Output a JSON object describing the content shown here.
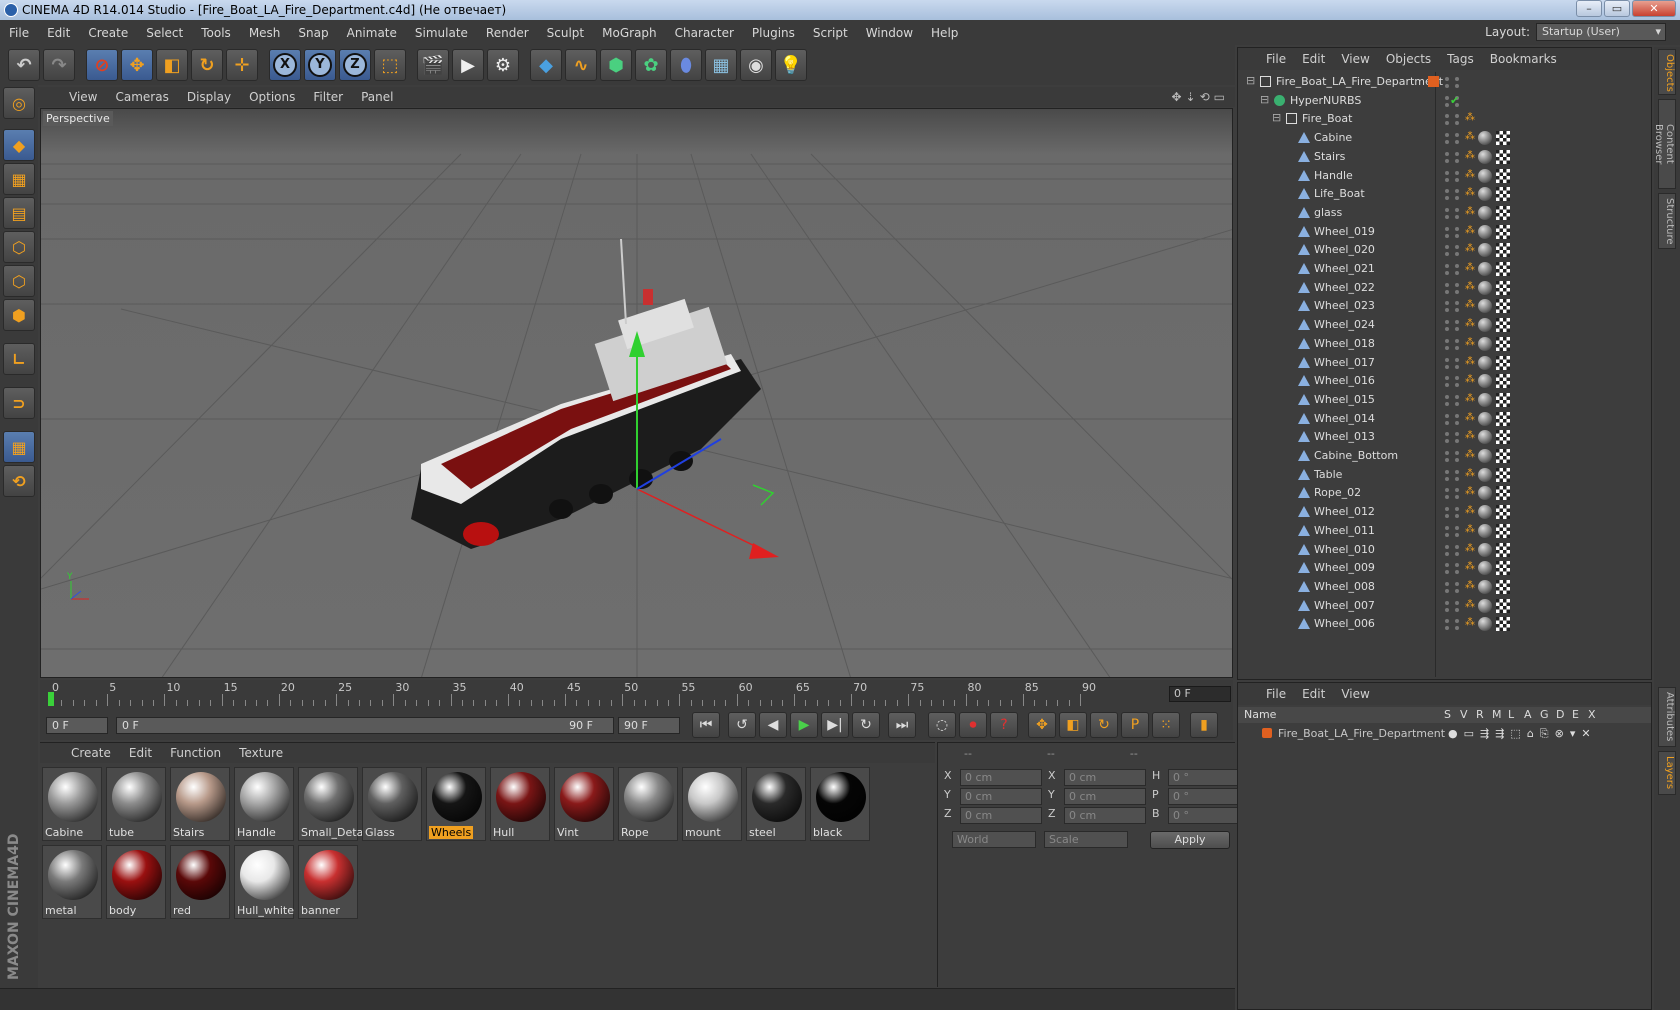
{
  "window": {
    "title": "CINEMA 4D R14.014 Studio - [Fire_Boat_LA_Fire_Department.c4d] (Не отвечает)"
  },
  "menu": [
    "File",
    "Edit",
    "Create",
    "Select",
    "Tools",
    "Mesh",
    "Snap",
    "Animate",
    "Simulate",
    "Render",
    "Sculpt",
    "MoGraph",
    "Character",
    "Plugins",
    "Script",
    "Window",
    "Help"
  ],
  "layout": {
    "label": "Layout:",
    "value": "Startup (User)"
  },
  "viewport": {
    "menu": [
      "View",
      "Cameras",
      "Display",
      "Options",
      "Filter",
      "Panel"
    ],
    "label": "Perspective"
  },
  "timeline": {
    "ticks": [
      "0",
      "5",
      "10",
      "15",
      "20",
      "25",
      "30",
      "35",
      "40",
      "45",
      "50",
      "55",
      "60",
      "65",
      "70",
      "75",
      "80",
      "85",
      "90"
    ],
    "current_frame": "0 F"
  },
  "transport": {
    "start": "0 F",
    "range_start": "0 F",
    "range_end": "90 F",
    "end": "90 F"
  },
  "materials": {
    "menu": [
      "Create",
      "Edit",
      "Function",
      "Texture"
    ],
    "items": [
      {
        "name": "Cabine",
        "color": "#9a9a9a"
      },
      {
        "name": "tube",
        "color": "#8c8c8c"
      },
      {
        "name": "Stairs",
        "color": "#b89a8a"
      },
      {
        "name": "Handle",
        "color": "#a8a8a8"
      },
      {
        "name": "Small_Deta",
        "color": "#707070"
      },
      {
        "name": "Glass",
        "color": "#606060"
      },
      {
        "name": "Wheels",
        "color": "#151515"
      },
      {
        "name": "Hull",
        "color": "#7a1515"
      },
      {
        "name": "Vint",
        "color": "#8a1a1a"
      },
      {
        "name": "Rope",
        "color": "#8a8a8a"
      },
      {
        "name": "mount",
        "color": "#c8c8c8"
      },
      {
        "name": "steel",
        "color": "#2a2a2a"
      },
      {
        "name": "black",
        "color": "#050505"
      },
      {
        "name": "metal",
        "color": "#7a7a7a"
      },
      {
        "name": "body",
        "color": "#9a1010"
      },
      {
        "name": "red",
        "color": "#5a0808"
      },
      {
        "name": "Hull_white",
        "color": "#e8e8e8"
      },
      {
        "name": "banner",
        "color": "#c83030"
      }
    ],
    "selected": "Wheels"
  },
  "coords": {
    "headers": [
      "--",
      "--",
      "--"
    ],
    "rows": [
      {
        "l1": "X",
        "v1": "0 cm",
        "l2": "X",
        "v2": "0 cm",
        "l3": "H",
        "v3": "0 °"
      },
      {
        "l1": "Y",
        "v1": "0 cm",
        "l2": "Y",
        "v2": "0 cm",
        "l3": "P",
        "v3": "0 °"
      },
      {
        "l1": "Z",
        "v1": "0 cm",
        "l2": "Z",
        "v2": "0 cm",
        "l3": "B",
        "v3": "0 °"
      }
    ],
    "mode1": "World",
    "mode2": "Scale",
    "apply": "Apply"
  },
  "objects": {
    "menu": [
      "File",
      "Edit",
      "View",
      "Objects",
      "Tags",
      "Bookmarks"
    ],
    "tree": [
      {
        "name": "Fire_Boat_LA_Fire_Department",
        "level": 0,
        "type": "null"
      },
      {
        "name": "HyperNURBS",
        "level": 1,
        "type": "nurbs"
      },
      {
        "name": "Fire_Boat",
        "level": 2,
        "type": "null"
      },
      {
        "name": "Cabine",
        "level": 3,
        "type": "poly"
      },
      {
        "name": "Stairs",
        "level": 3,
        "type": "poly"
      },
      {
        "name": "Handle",
        "level": 3,
        "type": "poly"
      },
      {
        "name": "Life_Boat",
        "level": 3,
        "type": "poly"
      },
      {
        "name": "glass",
        "level": 3,
        "type": "poly"
      },
      {
        "name": "Wheel_019",
        "level": 3,
        "type": "poly"
      },
      {
        "name": "Wheel_020",
        "level": 3,
        "type": "poly"
      },
      {
        "name": "Wheel_021",
        "level": 3,
        "type": "poly"
      },
      {
        "name": "Wheel_022",
        "level": 3,
        "type": "poly"
      },
      {
        "name": "Wheel_023",
        "level": 3,
        "type": "poly"
      },
      {
        "name": "Wheel_024",
        "level": 3,
        "type": "poly"
      },
      {
        "name": "Wheel_018",
        "level": 3,
        "type": "poly"
      },
      {
        "name": "Wheel_017",
        "level": 3,
        "type": "poly"
      },
      {
        "name": "Wheel_016",
        "level": 3,
        "type": "poly"
      },
      {
        "name": "Wheel_015",
        "level": 3,
        "type": "poly"
      },
      {
        "name": "Wheel_014",
        "level": 3,
        "type": "poly"
      },
      {
        "name": "Wheel_013",
        "level": 3,
        "type": "poly"
      },
      {
        "name": "Cabine_Bottom",
        "level": 3,
        "type": "poly"
      },
      {
        "name": "Table",
        "level": 3,
        "type": "poly"
      },
      {
        "name": "Rope_02",
        "level": 3,
        "type": "poly"
      },
      {
        "name": "Wheel_012",
        "level": 3,
        "type": "poly"
      },
      {
        "name": "Wheel_011",
        "level": 3,
        "type": "poly"
      },
      {
        "name": "Wheel_010",
        "level": 3,
        "type": "poly"
      },
      {
        "name": "Wheel_009",
        "level": 3,
        "type": "poly"
      },
      {
        "name": "Wheel_008",
        "level": 3,
        "type": "poly"
      },
      {
        "name": "Wheel_007",
        "level": 3,
        "type": "poly"
      },
      {
        "name": "Wheel_006",
        "level": 3,
        "type": "poly"
      }
    ]
  },
  "layers": {
    "menu": [
      "File",
      "Edit",
      "View"
    ],
    "columns": [
      "Name",
      "S",
      "V",
      "R",
      "M",
      "L",
      "A",
      "G",
      "D",
      "E",
      "X"
    ],
    "row": "Fire_Boat_LA_Fire_Department"
  },
  "sidetabs": [
    "Objects",
    "Content Browser",
    "Structure",
    "Attributes",
    "Layers"
  ],
  "brand": "MAXON CINEMA4D"
}
